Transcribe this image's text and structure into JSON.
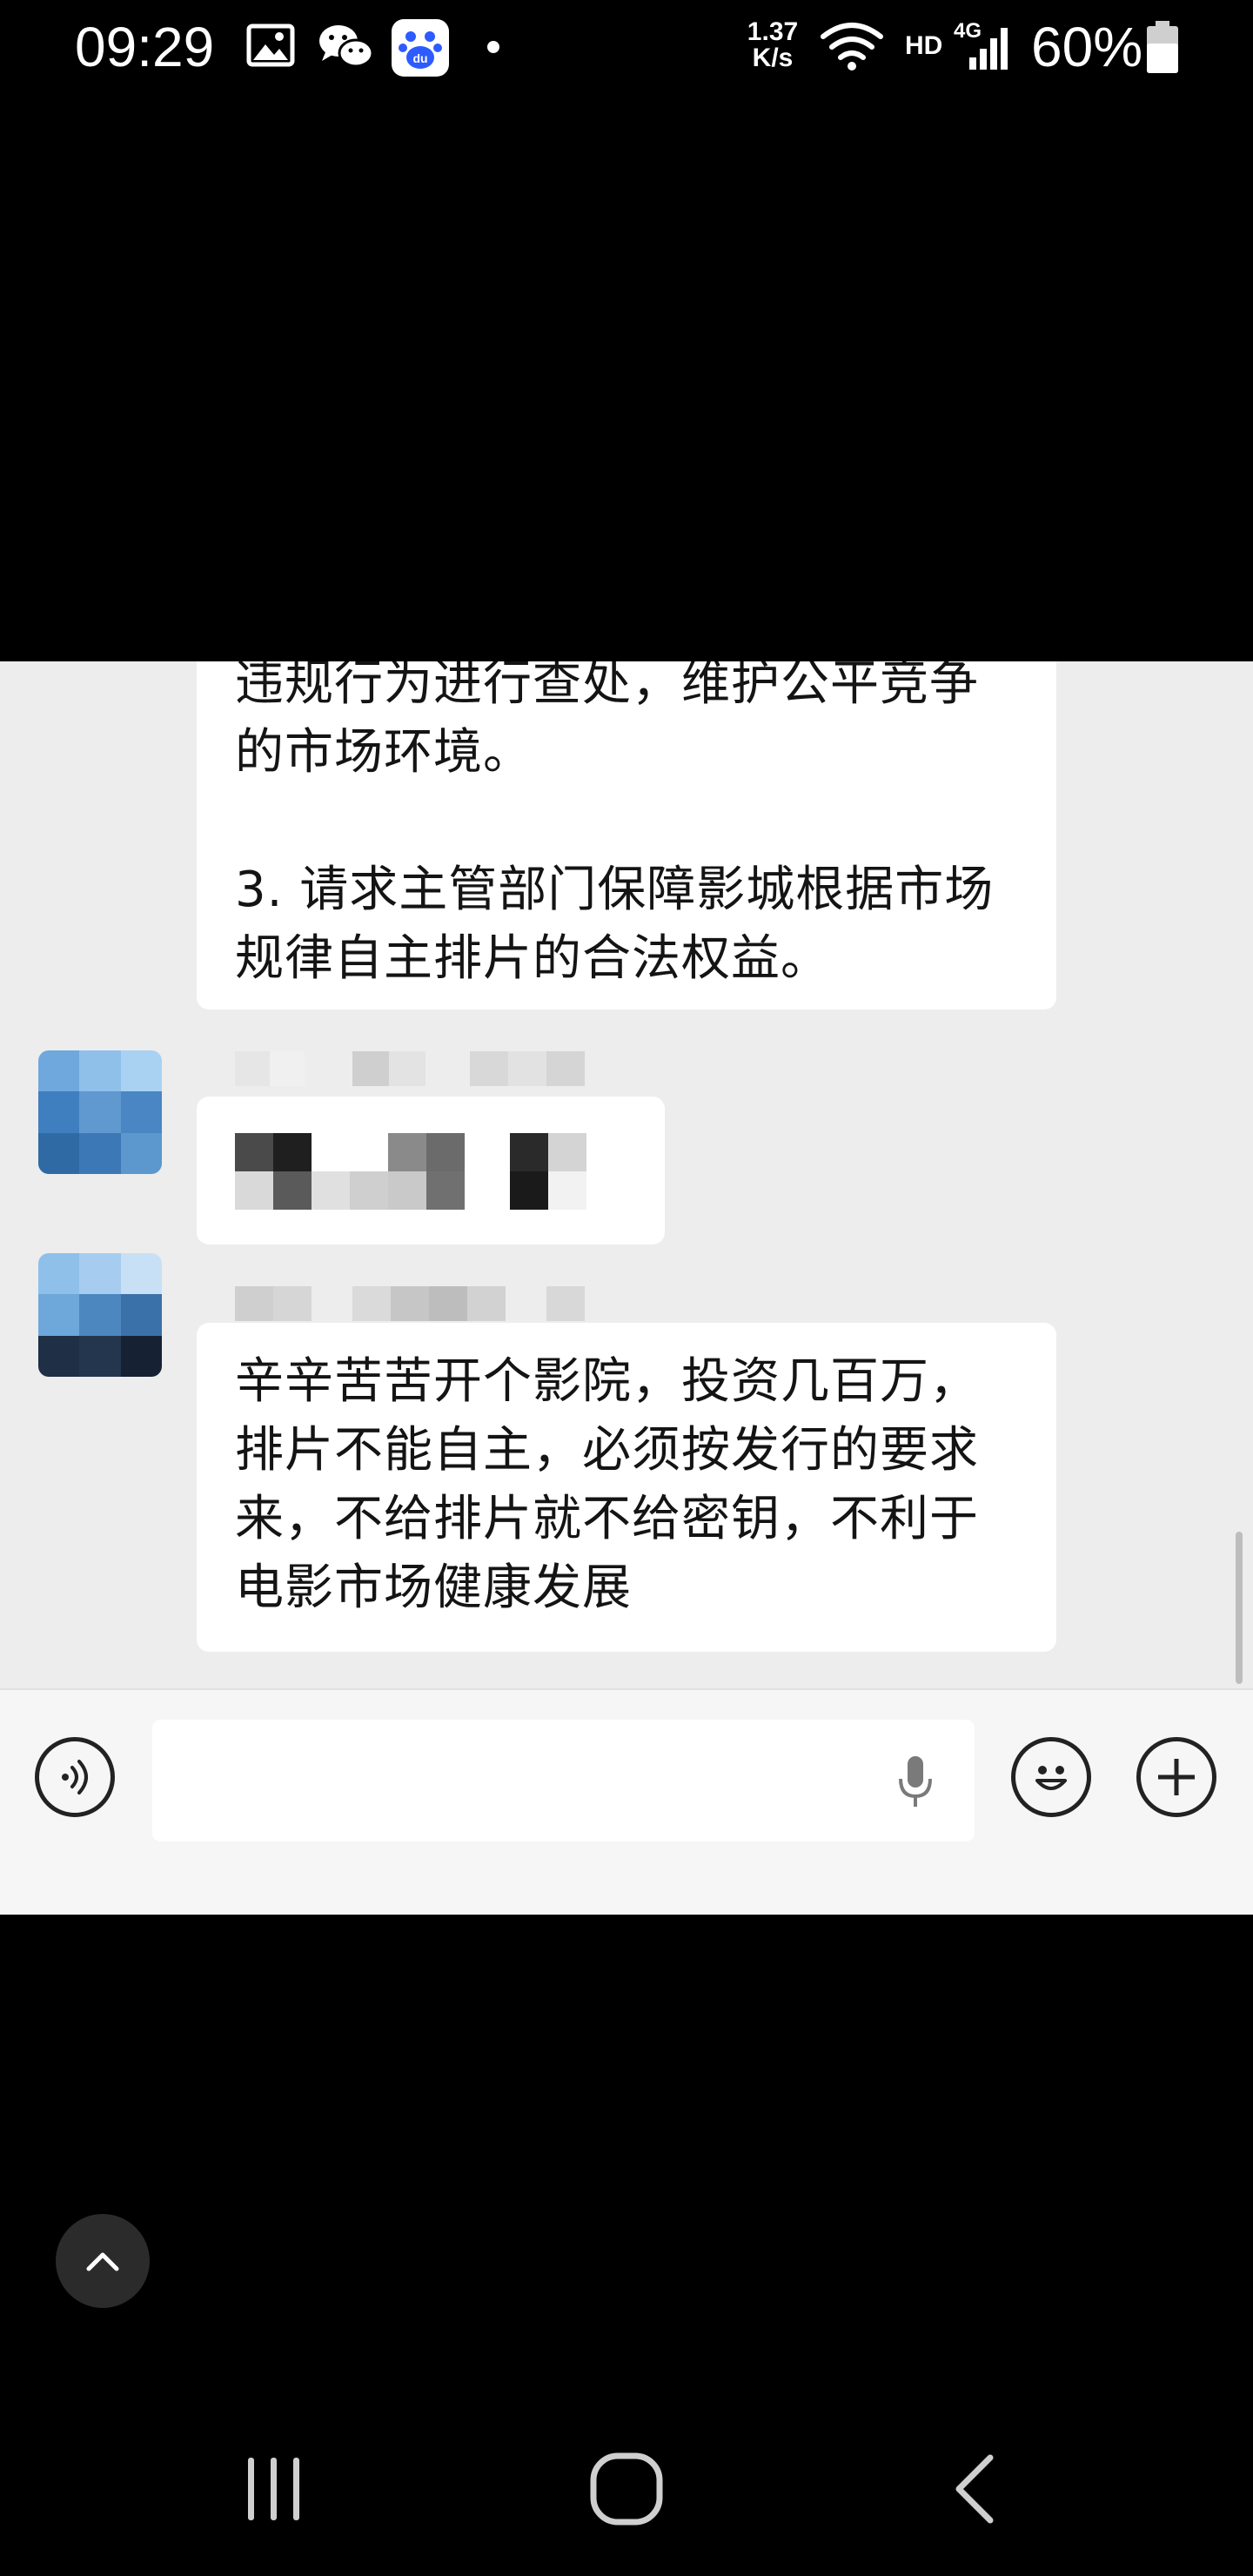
{
  "status_bar": {
    "time": "09:29",
    "notification_icons": [
      "gallery-icon",
      "wechat-icon",
      "baidu-icon",
      "dot-icon"
    ],
    "net_speed_value": "1.37",
    "net_speed_unit": "K/s",
    "hd_label": "HD",
    "network_label": "4G",
    "battery_percent": "60%"
  },
  "chat": {
    "messages": [
      {
        "sender_blurred": true,
        "lines": [
          "违规行为进行查处，维护公平竞争",
          "的市场环境。",
          "",
          "3. 请求主管部门保障影城根据市场",
          "规律自主排片的合法权益。"
        ]
      },
      {
        "sender_blurred": true,
        "content_blurred": true
      },
      {
        "sender_blurred": true,
        "lines": [
          "辛辛苦苦开个影院，投资几百万，",
          "排片不能自主，必须按发行的要求",
          "来，不给排片就不给密钥，不利于",
          "电影市场健康发展"
        ]
      }
    ]
  },
  "input_bar": {
    "voice_icon": "voice-icon",
    "mic_icon": "microphone-icon",
    "emoji_icon": "emoji-icon",
    "plus_icon": "plus-icon"
  },
  "nav_bar": {
    "recents_icon": "recents-icon",
    "home_icon": "home-icon",
    "back_icon": "back-icon",
    "scroll_top_icon": "chevron-up-icon"
  },
  "colors": {
    "chat_background": "#ededed",
    "bubble": "#ffffff",
    "text": "#141414"
  }
}
